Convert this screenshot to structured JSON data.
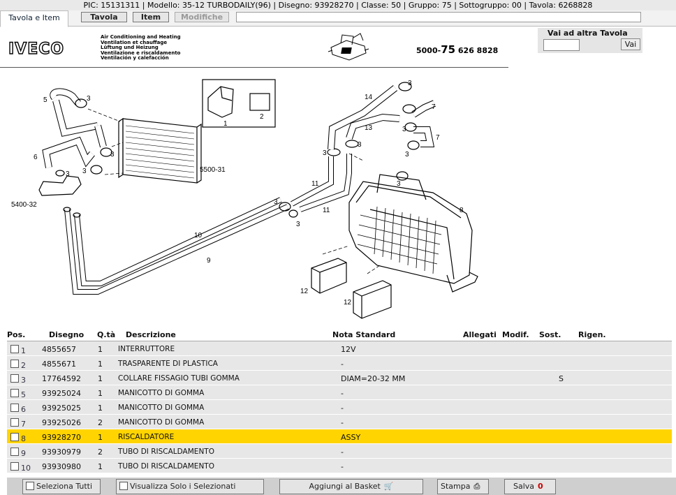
{
  "infobar": {
    "text": "PIC: 15131311 | Modello: 35-12 TURBODAILY(96) | Disegno: 93928270 | Classe: 50 | Gruppo: 75 | Sottogruppo: 00 | Tavola: 6268828"
  },
  "tabs": {
    "active_label": "Tavola e Item",
    "tavola_label": "Tavola",
    "item_label": "Item",
    "modifiche_label": "Modifiche"
  },
  "header": {
    "logo": "IVECO",
    "titles": [
      "Air Conditioning and Heating",
      "Ventilation et chauffage",
      "Lüftung und Heizung",
      "Ventilazione e riscaldamento",
      "Ventilación y calefacción"
    ],
    "code_prefix": "5000-",
    "code_big": "75",
    "code_suffix": " 626  8828"
  },
  "goto": {
    "label": "Vai ad altra Tavola",
    "input_value": "",
    "button_label": "Vai"
  },
  "diagram": {
    "labels": {
      "l1": "1",
      "l2": "2",
      "l3": "3",
      "l5": "5",
      "l6": "6",
      "l7": "7",
      "l8": "8",
      "l9": "9",
      "l10": "10",
      "l11": "11",
      "l12": "12",
      "l13": "13",
      "l14": "14",
      "ref5500": "5500-31",
      "ref5400": "5400-32"
    }
  },
  "table": {
    "headers": {
      "pos": "Pos.",
      "disegno": "Disegno",
      "qta": "Q.tà",
      "descrizione": "Descrizione",
      "nota": "Nota Standard",
      "allegati": "Allegati",
      "modif": "Modif.",
      "sost": "Sost.",
      "rigen": "Rigen."
    },
    "rows": [
      {
        "pos": "1",
        "disegno": "4855657",
        "qta": "1",
        "descrizione": "INTERRUTTORE",
        "nota": "12V",
        "sost": ""
      },
      {
        "pos": "2",
        "disegno": "4855671",
        "qta": "1",
        "descrizione": "TRASPARENTE DI PLASTICA",
        "nota": "-",
        "sost": ""
      },
      {
        "pos": "3",
        "disegno": "17764592",
        "qta": "1",
        "descrizione": "COLLARE FISSAGIO TUBI GOMMA",
        "nota": "DIAM=20-32 MM",
        "sost": "S"
      },
      {
        "pos": "5",
        "disegno": "93925024",
        "qta": "1",
        "descrizione": "MANICOTTO DI GOMMA",
        "nota": "-",
        "sost": ""
      },
      {
        "pos": "6",
        "disegno": "93925025",
        "qta": "1",
        "descrizione": "MANICOTTO DI GOMMA",
        "nota": "-",
        "sost": ""
      },
      {
        "pos": "7",
        "disegno": "93925026",
        "qta": "2",
        "descrizione": "MANICOTTO DI GOMMA",
        "nota": "-",
        "sost": ""
      },
      {
        "pos": "8",
        "disegno": "93928270",
        "qta": "1",
        "descrizione": "RISCALDATORE",
        "nota": "ASSY",
        "sost": ""
      },
      {
        "pos": "9",
        "disegno": "93930979",
        "qta": "2",
        "descrizione": "TUBO DI RISCALDAMENTO",
        "nota": "-",
        "sost": ""
      },
      {
        "pos": "10",
        "disegno": "93930980",
        "qta": "1",
        "descrizione": "TUBO DI RISCALDAMENTO",
        "nota": "-",
        "sost": ""
      }
    ],
    "selected_index": 6
  },
  "footer": {
    "select_all": "Seleziona Tutti",
    "show_selected": "Visualizza Solo i Selezionati",
    "add_basket": "Aggiungi al Basket",
    "print": "Stampa",
    "save": "Salva",
    "save_count": "0"
  },
  "colors": {
    "selected_row": "#ffd400",
    "row_bg": "#e7e7e7"
  }
}
